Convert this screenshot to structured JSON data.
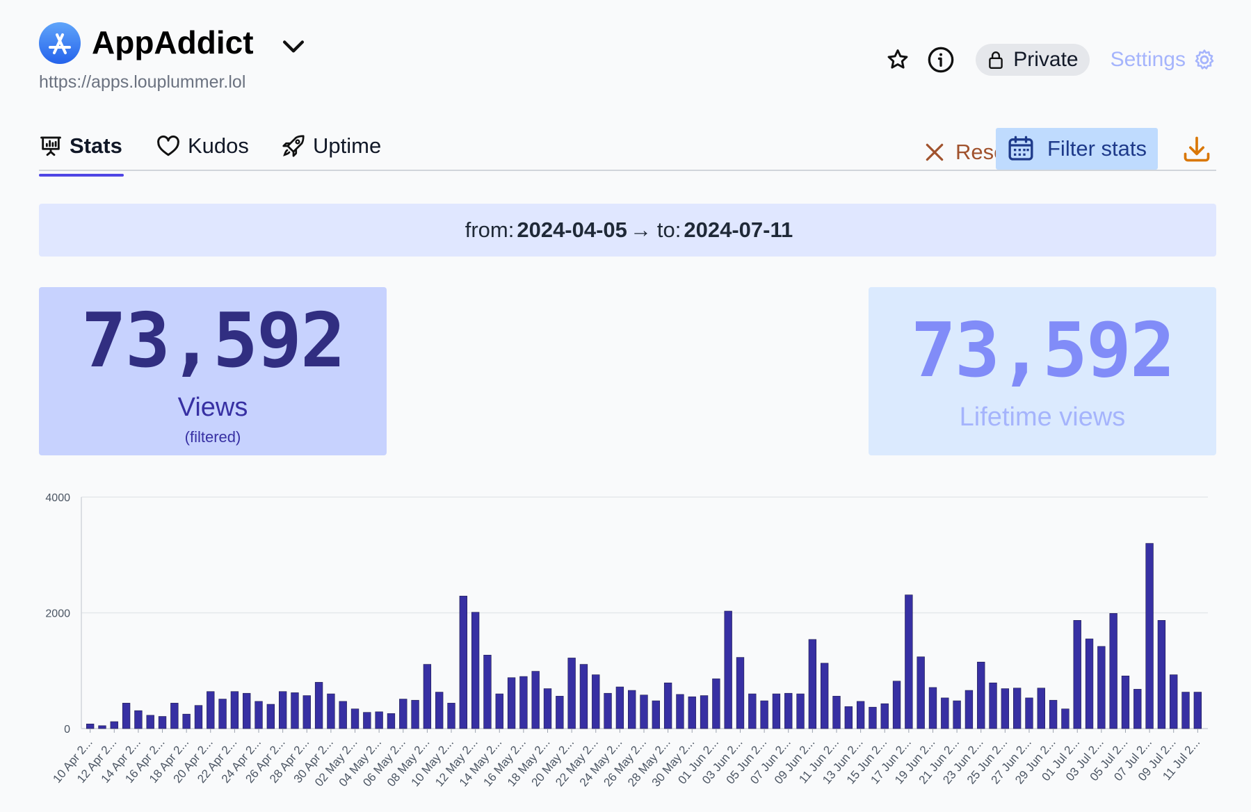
{
  "app": {
    "name": "AppAddict",
    "url": "https://apps.louplummer.lol"
  },
  "top_actions": {
    "private_label": "Private",
    "settings_label": "Settings"
  },
  "tabs": [
    {
      "label": "Stats",
      "icon": "presentation-chart-icon",
      "active": true
    },
    {
      "label": "Kudos",
      "icon": "heart-icon",
      "active": false
    },
    {
      "label": "Uptime",
      "icon": "rocket-icon",
      "active": false
    }
  ],
  "toolbar": {
    "reset_label": "Reset",
    "filter_label": "Filter stats"
  },
  "range": {
    "from_label": "from:",
    "from": "2024-04-05",
    "arrow": "→",
    "to_label": "to:",
    "to": "2024-07-11"
  },
  "cards": {
    "filtered_value": "73,592",
    "filtered_label": "Views",
    "filtered_sub": "(filtered)",
    "lifetime_value": "73,592",
    "lifetime_label": "Lifetime views"
  },
  "colors": {
    "bar": "#3730a3",
    "accent": "#4f46e5",
    "reset": "#a0522d",
    "download": "#d97706"
  },
  "chart_data": {
    "type": "bar",
    "ylim": [
      0,
      4000
    ],
    "yticks": [
      0,
      2000,
      4000
    ],
    "grid": true,
    "tick_labels": [
      "10 Apr 2...",
      "12 Apr 2...",
      "14 Apr 2...",
      "16 Apr 2...",
      "18 Apr 2...",
      "20 Apr 2...",
      "22 Apr 2...",
      "24 Apr 2...",
      "26 Apr 2...",
      "28 Apr 2...",
      "30 Apr 2...",
      "02 May 2...",
      "04 May 2...",
      "06 May 2...",
      "08 May 2...",
      "10 May 2...",
      "12 May 2...",
      "14 May 2...",
      "16 May 2...",
      "18 May 2...",
      "20 May 2...",
      "22 May 2...",
      "24 May 2...",
      "26 May 2...",
      "28 May 2...",
      "30 May 2...",
      "01 Jun 2...",
      "03 Jun 2...",
      "05 Jun 2...",
      "07 Jun 2...",
      "09 Jun 2...",
      "11 Jun 2...",
      "13 Jun 2...",
      "15 Jun 2...",
      "17 Jun 2...",
      "19 Jun 2...",
      "21 Jun 2...",
      "23 Jun 2...",
      "25 Jun 2...",
      "27 Jun 2...",
      "29 Jun 2...",
      "01 Jul 2...",
      "03 Jul 2...",
      "05 Jul 2...",
      "07 Jul 2...",
      "09 Jul 2...",
      "11 Jul 2..."
    ],
    "values": [
      80,
      50,
      120,
      440,
      310,
      230,
      210,
      440,
      250,
      400,
      640,
      510,
      640,
      610,
      470,
      420,
      640,
      620,
      570,
      800,
      600,
      470,
      340,
      280,
      290,
      260,
      510,
      490,
      1110,
      630,
      440,
      2290,
      2010,
      1270,
      600,
      880,
      900,
      990,
      690,
      560,
      1220,
      1110,
      930,
      610,
      720,
      660,
      580,
      480,
      790,
      590,
      550,
      570,
      860,
      2030,
      1230,
      600,
      480,
      600,
      610,
      600,
      1540,
      1130,
      560,
      380,
      470,
      370,
      430,
      820,
      2310,
      1240,
      710,
      530,
      480,
      660,
      1150,
      790,
      690,
      700,
      530,
      700,
      490,
      340,
      1870,
      1550,
      1420,
      1990,
      910,
      680,
      3200,
      1870,
      930,
      630,
      630
    ]
  }
}
